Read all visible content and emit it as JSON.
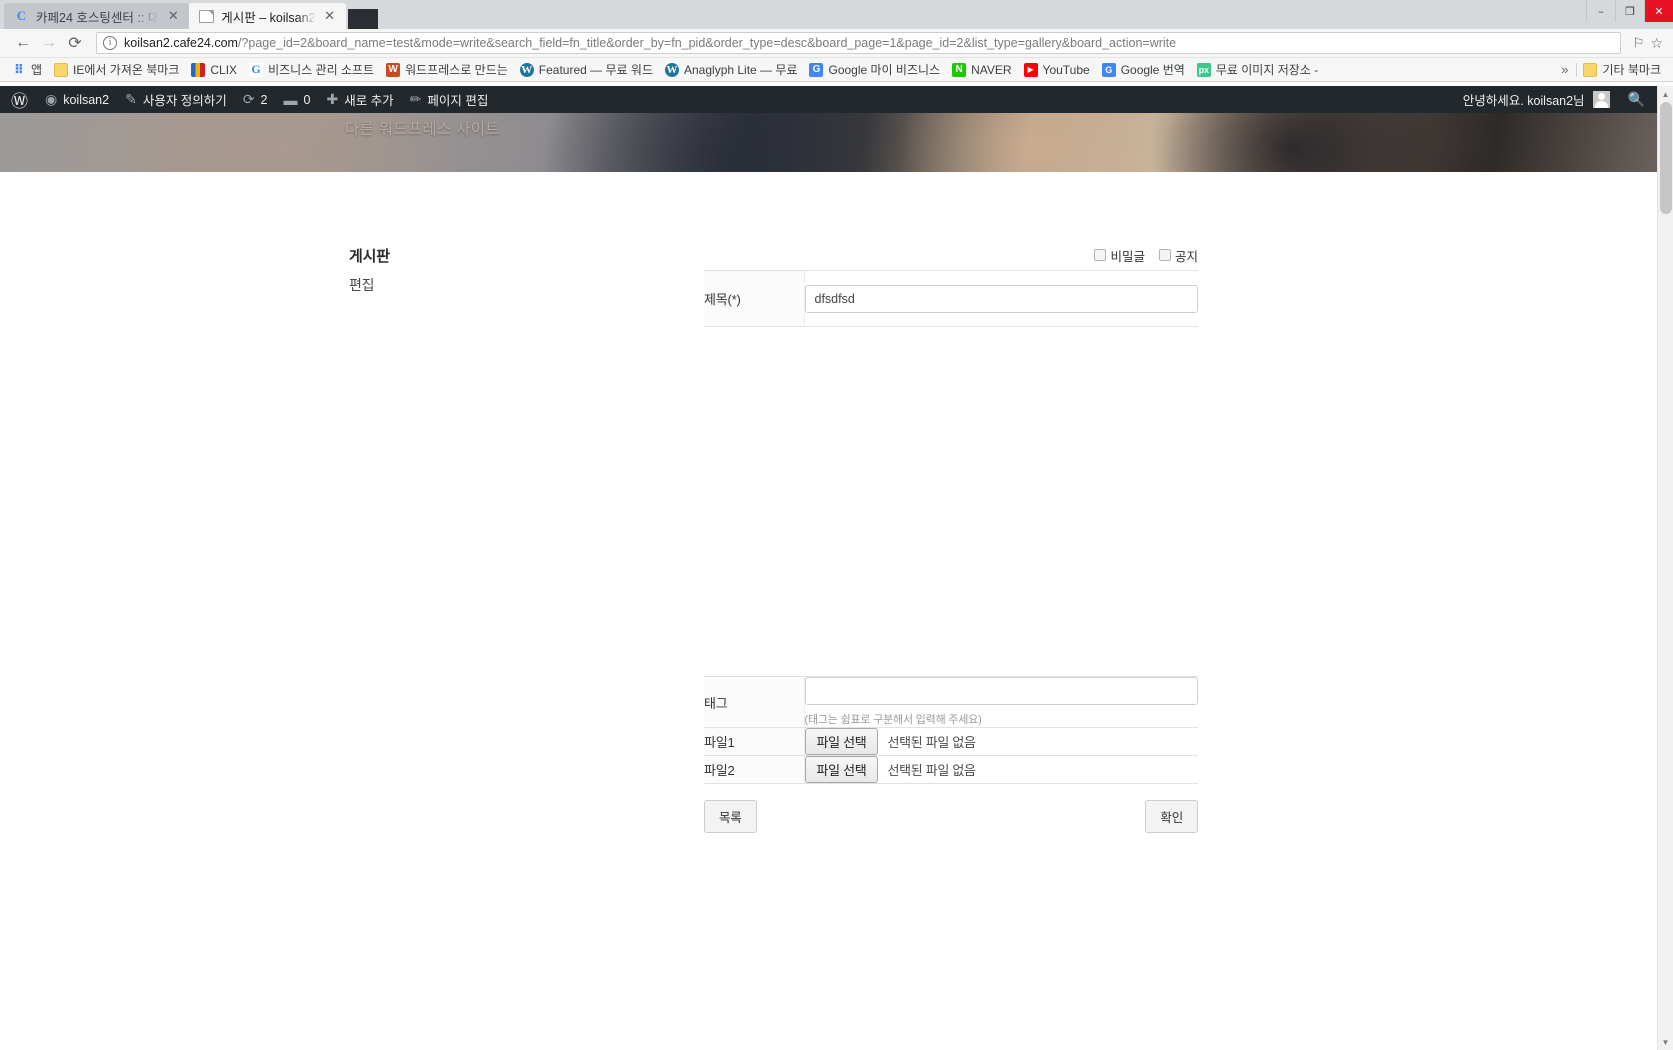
{
  "window": {
    "minimize": "–",
    "maximize": "❐",
    "close": "✕"
  },
  "tabs": [
    {
      "title": "카페24 호스팅센터 :: 대",
      "favicon": "chrome-logo-icon",
      "active": false,
      "close": "✕"
    },
    {
      "title": "게시판 – koilsan2",
      "favicon": "page-icon",
      "active": true,
      "close": "✕"
    }
  ],
  "toolbar": {
    "back": "←",
    "forward": "→",
    "reload": "⟳",
    "info_icon": "i",
    "url_host": "koilsan2.cafe24.com",
    "url_path": "/?page_id=2&board_name=test&mode=write&search_field=fn_title&order_by=fn_pid&order_type=desc&board_page=1&page_id=2&list_type=gallery&board_action=write",
    "translate_icon": "⚐",
    "bookmark_star": "☆"
  },
  "bookmarks": {
    "items": [
      {
        "label": "앱",
        "icon": "apps-grid-icon"
      },
      {
        "label": "IE에서 가져온 북마크",
        "icon": "folder-icon"
      },
      {
        "label": "CLIX",
        "icon": "clix-icon"
      },
      {
        "label": "비즈니스 관리 소프트",
        "icon": "google-g-icon"
      },
      {
        "label": "워드프레스로 만드는",
        "icon": "wordpress-dark-icon"
      },
      {
        "label": "Featured — 무료 워드",
        "icon": "wordpress-icon"
      },
      {
        "label": "Anaglyph Lite — 무료",
        "icon": "wordpress-icon"
      },
      {
        "label": "Google 마이 비즈니스",
        "icon": "google-my-business-icon"
      },
      {
        "label": "NAVER",
        "icon": "naver-icon"
      },
      {
        "label": "YouTube",
        "icon": "youtube-icon"
      },
      {
        "label": "Google 번역",
        "icon": "google-translate-icon"
      },
      {
        "label": "무료 이미지 저장소 -",
        "icon": "px-icon"
      }
    ],
    "overflow": "»",
    "other_label": "기타 북마크",
    "other_icon": "folder-icon"
  },
  "wpbar": {
    "logo": "Ⓦ",
    "site_name": "koilsan2",
    "site_icon": "dashboard-icon",
    "customize": "사용자 정의하기",
    "customize_icon": "brush-icon",
    "updates_count": "2",
    "updates_icon": "update-arrows-icon",
    "comments_count": "0",
    "comments_icon": "comment-bubble-icon",
    "new_label": "새로 추가",
    "new_icon": "plus-icon",
    "edit_page": "페이지 편집",
    "edit_icon": "pencil-icon",
    "greeting": "안녕하세요. koilsan2님",
    "avatar": "avatar-icon",
    "search_icon": "search-icon"
  },
  "banner": {
    "tagline": "다른 워드프레스 사이트"
  },
  "board": {
    "title": "게시판",
    "subtitle": "편집",
    "options": [
      {
        "label": "비밀글",
        "checked": false
      },
      {
        "label": "공지",
        "checked": false
      }
    ],
    "fields": {
      "title_label": "제목(*)",
      "title_value": "dfsdfsd",
      "title_placeholder": "",
      "tag_label": "태그",
      "tag_value": "",
      "tag_placeholder": "",
      "tag_hint": "(태그는 쉼표로 구분해서 입력해 주세요)",
      "file1_label": "파일1",
      "file2_label": "파일2",
      "file_button": "파일 선택",
      "file_status": "선택된 파일 없음"
    },
    "buttons": {
      "list": "목록",
      "submit": "확인"
    }
  },
  "scrollbar": {
    "up": "▲",
    "down": "▼"
  }
}
